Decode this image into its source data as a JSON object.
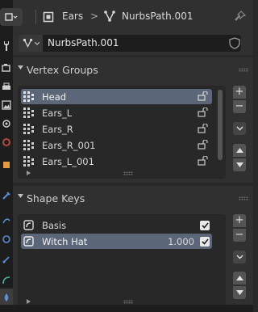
{
  "header": {
    "object_name": "Ears",
    "separator": ">",
    "data_name": "NurbsPath.001"
  },
  "datablock": {
    "name": "NurbsPath.001"
  },
  "vertex_groups": {
    "title": "Vertex Groups",
    "items": [
      {
        "label": "Head",
        "selected": true
      },
      {
        "label": "Ears_L",
        "selected": false
      },
      {
        "label": "Ears_R",
        "selected": false
      },
      {
        "label": "Ears_R_001",
        "selected": false
      },
      {
        "label": "Ears_L_001",
        "selected": false
      }
    ]
  },
  "shape_keys": {
    "title": "Shape Keys",
    "items": [
      {
        "label": "Basis",
        "value": "",
        "checked": true,
        "selected": false
      },
      {
        "label": "Witch Hat",
        "value": "1.000",
        "checked": true,
        "selected": true
      }
    ]
  },
  "side_buttons": {
    "add": "+",
    "remove": "−"
  },
  "colors": {
    "selection": "#5b6678",
    "panel": "#303030",
    "background": "#282828"
  }
}
